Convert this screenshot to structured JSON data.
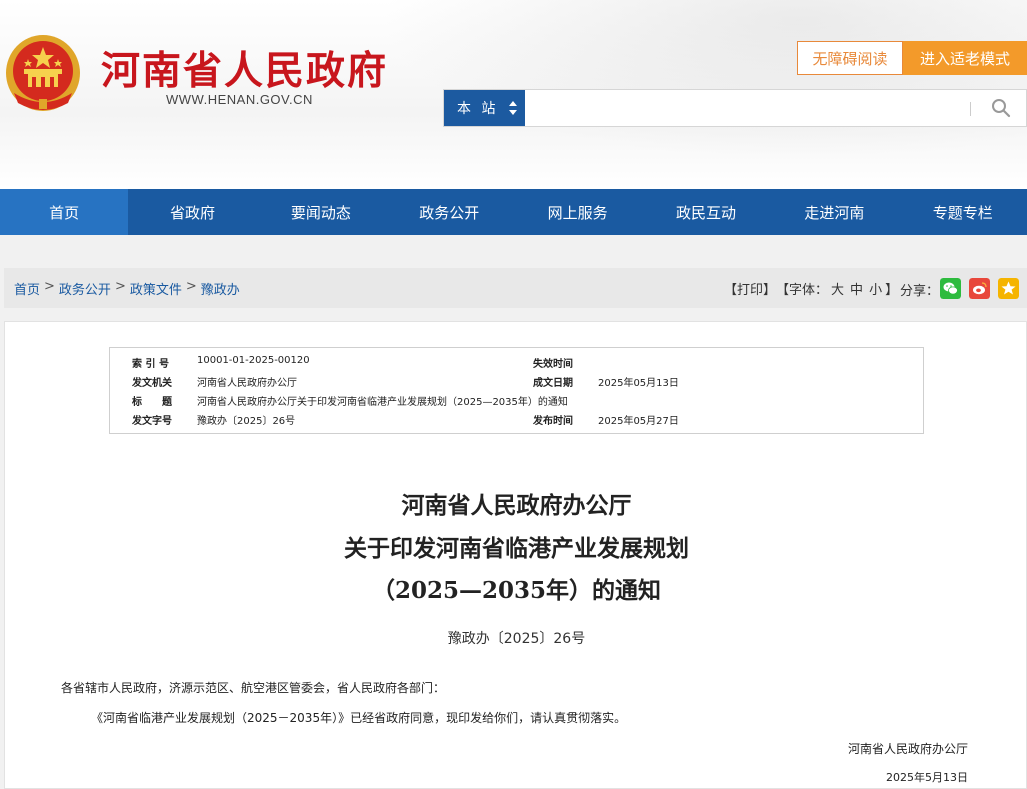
{
  "header": {
    "site_title": "河南省人民政府",
    "site_url": "WWW.HENAN.GOV.CN",
    "accessibility_label": "无障碍阅读",
    "elder_mode_label": "进入适老模式",
    "search_scope": "本 站",
    "search_value": ""
  },
  "nav": {
    "items": [
      "首页",
      "省政府",
      "要闻动态",
      "政务公开",
      "网上服务",
      "政民互动",
      "走进河南",
      "专题专栏"
    ],
    "active_index": 0
  },
  "breadcrumb": {
    "items": [
      "首页",
      "政务公开",
      "政策文件",
      "豫政办"
    ],
    "separator": ">"
  },
  "tools": {
    "print": "【打印】",
    "font_prefix": "【字体：",
    "font_large": "大",
    "font_medium": "中",
    "font_small": "小",
    "font_suffix": "】",
    "share_label": "分享："
  },
  "meta": {
    "index_no_label": "索 引 号",
    "index_no": "10001-01-2025-00120",
    "expiry_label": "失效时间",
    "expiry": "",
    "issuer_label": "发文机关",
    "issuer": "河南省人民政府办公厅",
    "created_label": "成文日期",
    "created": "2025年05月13日",
    "title_label": "标　　题",
    "title": "河南省人民政府办公厅关于印发河南省临港产业发展规划（2025—2035年）的通知",
    "doc_no_label": "发文字号",
    "doc_no": "豫政办〔2025〕26号",
    "published_label": "发布时间",
    "published": "2025年05月27日"
  },
  "document": {
    "title_line1": "河南省人民政府办公厅",
    "title_line2": "关于印发河南省临港产业发展规划",
    "title_line3": "（2025—2035年）的通知",
    "doc_no": "豫政办〔2025〕26号",
    "addressee": "各省辖市人民政府，济源示范区、航空港区管委会，省人民政府各部门：",
    "body": "《河南省临港产业发展规划（2025－2035年）》已经省政府同意，现印发给你们，请认真贯彻落实。",
    "signature": "河南省人民政府办公厅",
    "date": "2025年5月13日"
  },
  "colors": {
    "brand_red": "#c8161d",
    "nav_blue": "#1a5aa1",
    "nav_active": "#2773c2",
    "accent_orange": "#f39a2a"
  },
  "icons": {
    "emblem": "national-emblem-icon",
    "search": "search-icon",
    "wechat": "wechat-icon",
    "weibo": "weibo-icon",
    "favorite": "star-icon"
  }
}
